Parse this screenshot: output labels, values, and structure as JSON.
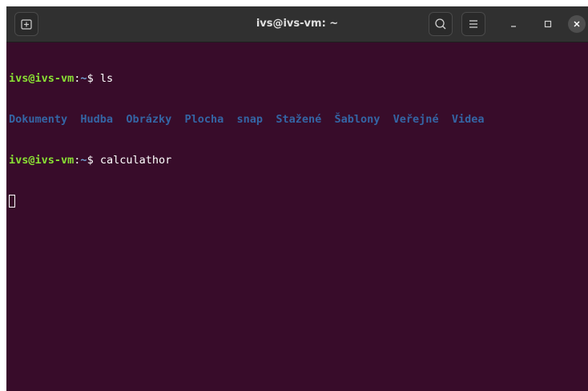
{
  "window": {
    "title": "ivs@ivs-vm: ~"
  },
  "titlebar": {
    "new_tab_icon": "new-tab-icon",
    "search_icon": "search-icon",
    "menu_icon": "hamburger-menu-icon",
    "minimize_icon": "minimize-icon",
    "maximize_icon": "maximize-icon",
    "close_icon": "close-icon"
  },
  "terminal": {
    "prompt_user": "ivs@ivs-vm",
    "prompt_sep": ":",
    "prompt_path": "~",
    "prompt_symbol": "$ ",
    "command_1": "ls",
    "ls_output": [
      "Dokumenty",
      "Hudba",
      "Obrázky",
      "Plocha",
      "snap",
      "Stažené",
      "Šablony",
      "Veřejné",
      "Videa"
    ],
    "command_2": "calculathor"
  },
  "colors": {
    "background": "#380c2a",
    "titlebar": "#303030",
    "prompt_user": "#8ae234",
    "prompt_path": "#729fcf",
    "directory": "#3465a4",
    "text": "#ffffff"
  }
}
